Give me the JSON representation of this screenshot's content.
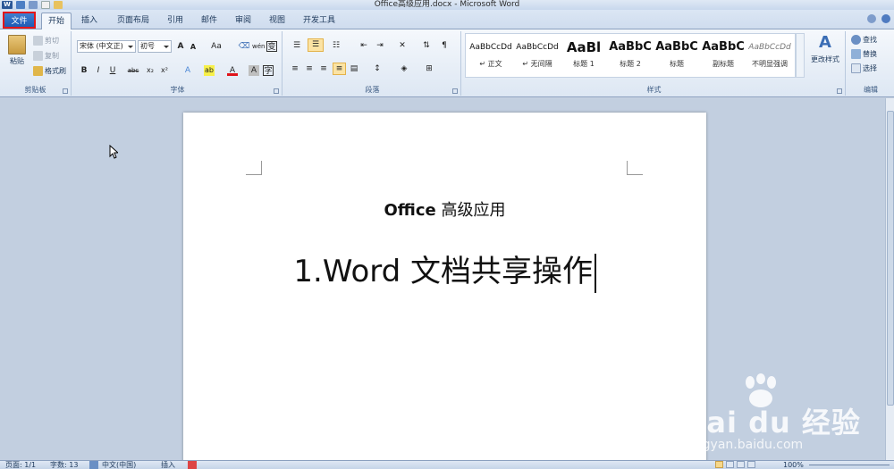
{
  "window": {
    "title": "Office高级应用.docx - Microsoft Word",
    "app_icon_text": "W"
  },
  "tabs": {
    "file": "文件",
    "items": [
      "开始",
      "插入",
      "页面布局",
      "引用",
      "邮件",
      "审阅",
      "视图",
      "开发工具"
    ],
    "active": "开始"
  },
  "clipboard": {
    "paste": "粘贴",
    "cut": "剪切",
    "copy": "复制",
    "format_painter": "格式刷",
    "label": "剪贴板"
  },
  "font": {
    "font_name": "宋体 (中文正)",
    "font_size": "初号",
    "label": "字体",
    "change_case": "Aa",
    "phonetic": "wén",
    "char_border": "变",
    "bold": "B",
    "italic": "I",
    "underline": "U",
    "strikethrough": "abc",
    "subscript": "x₂",
    "superscript": "x²",
    "text_effects": "A",
    "highlight": "ab",
    "font_color": "A",
    "char_shading": "A",
    "grow": "A",
    "shrink": "A"
  },
  "paragraph": {
    "label": "段落"
  },
  "styles": {
    "label": "样式",
    "change_styles": "更改样式",
    "items": [
      {
        "sample": "AaBbCcDd",
        "name": "↵ 正文"
      },
      {
        "sample": "AaBbCcDd",
        "name": "↵ 无间隔"
      },
      {
        "sample": "AaBl",
        "name": "标题 1"
      },
      {
        "sample": "AaBbC",
        "name": "标题 2"
      },
      {
        "sample": "AaBbC",
        "name": "标题"
      },
      {
        "sample": "AaBbC",
        "name": "副标题"
      },
      {
        "sample": "AaBbCcDd",
        "name": "不明显强调"
      }
    ]
  },
  "editing": {
    "label": "编辑",
    "find": "查找",
    "replace": "替换",
    "select": "选择"
  },
  "document": {
    "title_bold": "Office",
    "title_rest": " 高级应用",
    "heading": "1.Word 文档共享操作"
  },
  "status": {
    "page": "页面: 1/1",
    "words": "字数: 13",
    "language": "中文(中国)",
    "mode": "插入",
    "zoom": "100%"
  },
  "watermark": {
    "brand": "Bai du 经验",
    "url": "jingyan.baidu.com"
  },
  "colors": {
    "file_tab": "#1e5bb5",
    "highlight_box": "#e2161b",
    "ribbon_bg": "#dde7f3",
    "doc_bg": "#c2cfe0"
  }
}
